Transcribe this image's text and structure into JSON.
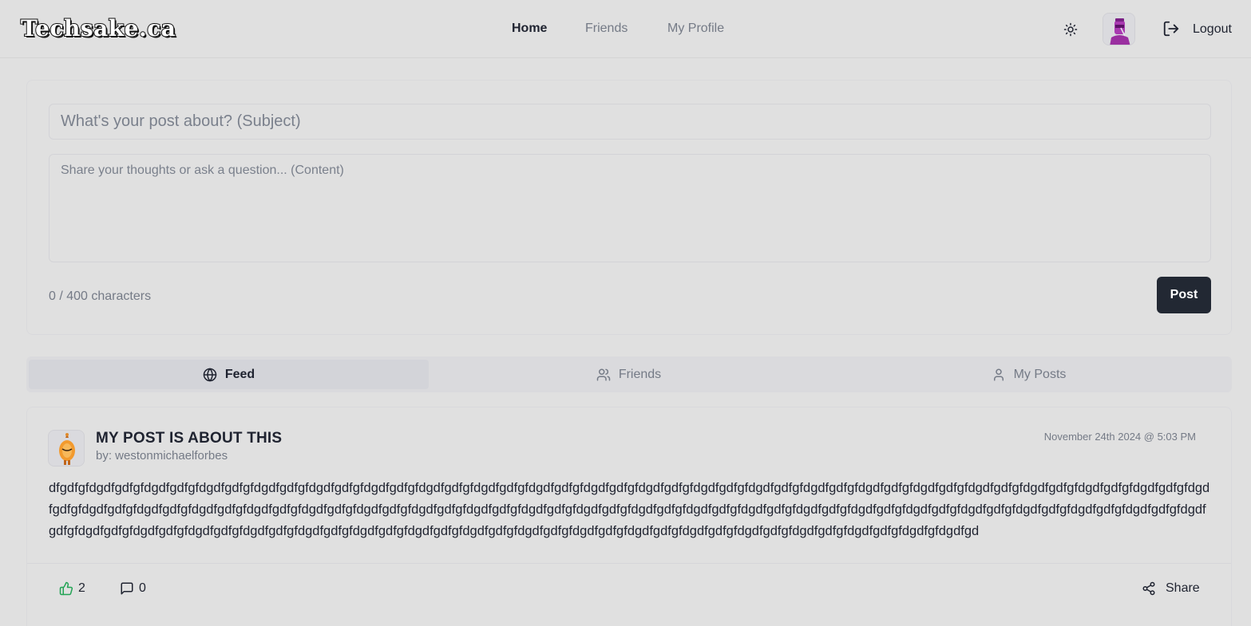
{
  "header": {
    "logo": "Techsake.ca",
    "nav": [
      {
        "label": "Home",
        "active": true
      },
      {
        "label": "Friends",
        "active": false
      },
      {
        "label": "My Profile",
        "active": false
      }
    ],
    "logout_label": "Logout"
  },
  "composer": {
    "subject_placeholder": "What's your post about? (Subject)",
    "content_placeholder": "Share your thoughts or ask a question... (Content)",
    "char_count": "0 / 400 characters",
    "post_label": "Post"
  },
  "tabs": [
    {
      "label": "Feed",
      "icon": "globe-icon",
      "active": true
    },
    {
      "label": "Friends",
      "icon": "users-icon",
      "active": false
    },
    {
      "label": "My Posts",
      "icon": "user-icon",
      "active": false
    }
  ],
  "post": {
    "title": "MY POST IS ABOUT THIS",
    "author": "by: westonmichaelforbes",
    "date": "November 24th 2024 @ 5:03 PM",
    "body": "dfgdfgfdgdfgdfgfdgdfgdfgfdgdfgdfgfdgdfgdfgfdgdfgdfgfdgdfgdfgfdgdfgdfgfdgdfgdfgfdgdfgdfgfdgdfgdfgfdgdfgdfgfdgdfgdfgfdgdfgdfgfdgdfgdfgfdgdfgdfgfdgdfgdfgfdgdfgdfgfdgdfgdfgfdgdfgdfgfdgdfgdfgfdgdfgdfgfdgdfgdfgfdgdfgdfgfdgdfgdfgfdgdfgdfgfdgdfgdfgfdgdfgdfgfdgdfgdfgfdgdfgdfgfdgdfgdfgfdgdfgdfgfdgdfgdfgfdgdfgdfgfdgdfgdfgfdgdfgdfgfdgdfgdfgfdgdfgdfgfdgdfgdfgfdgdfgdfgfdgdfgdfgfdgdfgdfgfdgdfgdfgfdgdfgdfgfdgdfgdfgfdgdfgdfgfdgdfgdfgfdgdfgdfgfdgdfgdfgfdgdfgdfgfdgdfgdfgfdgdfgdfgfdgdfgdfgfdgdfgdfgfdgdfgdfgfdgdfgdfgfdgdfgdfgfdgdfgdfgfdgdfgfdgdfgd",
    "likes": "2",
    "comments": "0",
    "share_label": "Share"
  },
  "colors": {
    "background": "#e0e0e0",
    "primary_button": "#222833",
    "like_green": "#22a354",
    "muted_text": "#747a86"
  }
}
